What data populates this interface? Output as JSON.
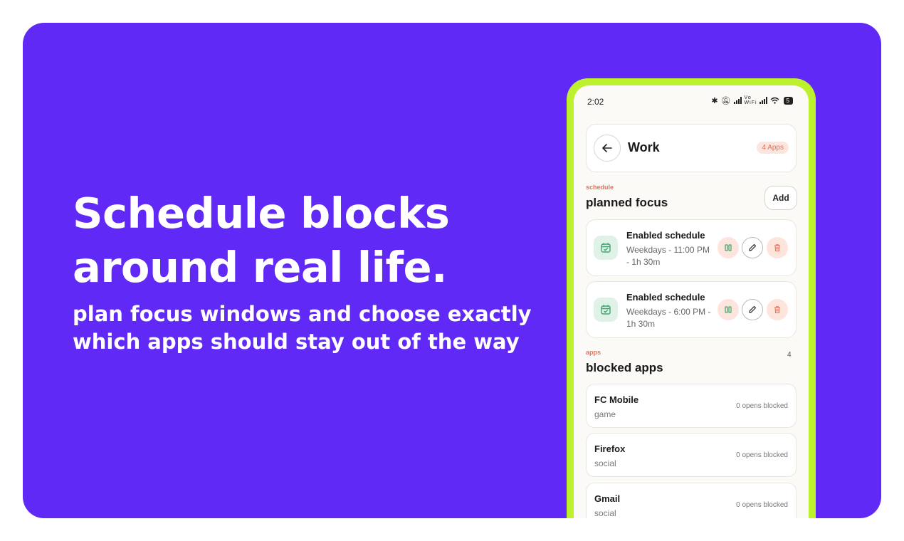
{
  "headline_line1": "Schedule blocks",
  "headline_line2": "around real life.",
  "subheadline": "plan focus windows and choose exactly which apps should stay out of the way",
  "colors": {
    "background": "#6129F5",
    "phone_frame": "#BDF12E",
    "accent": "#E9705A",
    "pill_bg": "#FDE5DD",
    "schedule_icon_bg": "#E0F2E8"
  },
  "status_bar": {
    "time": "2:02",
    "battery": "5"
  },
  "header": {
    "title": "Work",
    "badge": "4 Apps"
  },
  "schedule_section": {
    "tag": "schedule",
    "title": "planned focus",
    "add_label": "Add"
  },
  "schedules": [
    {
      "title": "Enabled schedule",
      "detail": "Weekdays - 11:00 PM - 1h 30m"
    },
    {
      "title": "Enabled schedule",
      "detail": "Weekdays - 6:00 PM - 1h 30m"
    }
  ],
  "apps_section": {
    "tag": "apps",
    "title": "blocked apps",
    "count": "4"
  },
  "apps": [
    {
      "name": "FC Mobile",
      "category": "game",
      "opens": "0 opens blocked"
    },
    {
      "name": "Firefox",
      "category": "social",
      "opens": "0 opens blocked"
    },
    {
      "name": "Gmail",
      "category": "social",
      "opens": "0 opens blocked"
    }
  ]
}
